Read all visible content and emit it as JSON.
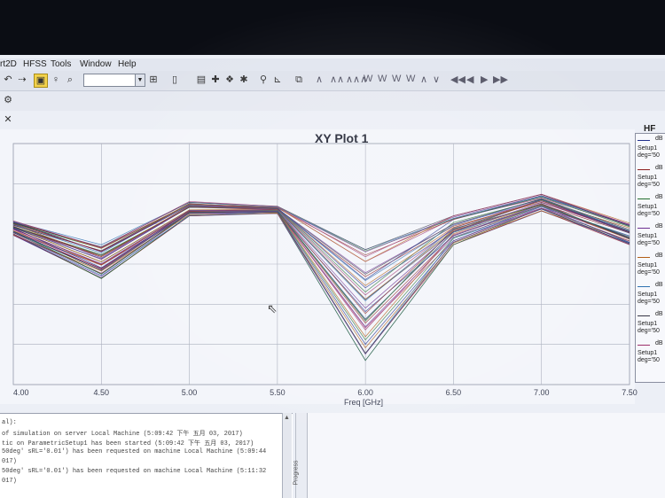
{
  "menubar": {
    "items": [
      "rt2D",
      "HFSS",
      "Tools",
      "Window",
      "Help"
    ]
  },
  "toolbar": {
    "wave_icons": [
      "∧",
      "∧∧",
      "∧∧∧",
      "W",
      "W",
      "W",
      "W",
      "∧",
      "∨"
    ],
    "nav_icons": [
      "◀◀",
      "◀",
      "▶",
      "▶▶"
    ]
  },
  "plot": {
    "title": "XY Plot 1",
    "xlabel": "Freq [GHz]",
    "legend_header": "HF",
    "legend_entries": [
      {
        "db": "dB",
        "setup": "Setup1",
        "deg": "deg='50"
      },
      {
        "db": "dB",
        "setup": "Setup1",
        "deg": "deg='50"
      },
      {
        "db": "dB",
        "setup": "Setup1",
        "deg": "deg='50"
      },
      {
        "db": "dB",
        "setup": "Setup1",
        "deg": "deg='50"
      },
      {
        "db": "dB",
        "setup": "Setup1",
        "deg": "deg='50"
      },
      {
        "db": "dB",
        "setup": "Setup1",
        "deg": "deg='50"
      },
      {
        "db": "dB",
        "setup": "Setup1",
        "deg": "deg='50"
      },
      {
        "db": "dB",
        "setup": "Setup1",
        "deg": "deg='50"
      }
    ]
  },
  "chart_data": {
    "type": "line",
    "title": "XY Plot 1",
    "xlabel": "Freq [GHz]",
    "ylabel": "",
    "xlim": [
      4.0,
      7.5
    ],
    "x": [
      4.0,
      4.5,
      5.0,
      5.5,
      6.0,
      6.5,
      7.0,
      7.5
    ],
    "xticks": [
      "4.00",
      "4.50",
      "5.00",
      "5.50",
      "6.00",
      "6.50",
      "7.00",
      "7.50"
    ],
    "ylim": [
      0,
      1
    ],
    "grid": true,
    "series_count": 40,
    "envelope_low": [
      0.62,
      0.44,
      0.7,
      0.71,
      0.1,
      0.58,
      0.72,
      0.58
    ],
    "envelope_high": [
      0.68,
      0.58,
      0.76,
      0.74,
      0.56,
      0.7,
      0.79,
      0.67
    ],
    "colors": [
      "#1f2d8a",
      "#8b1a1a",
      "#1f6b2a",
      "#6a2b8f",
      "#b05a12",
      "#2a6fb0",
      "#333344",
      "#9c2f6b"
    ]
  },
  "messages": {
    "lines": [
      "al):",
      "of simulation on server  Local Machine  (5:09:42 下午  五月 03, 2017)",
      "tic on ParametricSetup1 has been started  (5:09:42 下午  五月 03, 2017)",
      "50deg' sRL='0.01') has been requested on machine Local Machine  (5:09:44",
      "017)",
      "50deg' sRL='0.01') has been requested on machine Local Machine  (5:11:32",
      "017)"
    ],
    "progress_label": "Progress"
  }
}
